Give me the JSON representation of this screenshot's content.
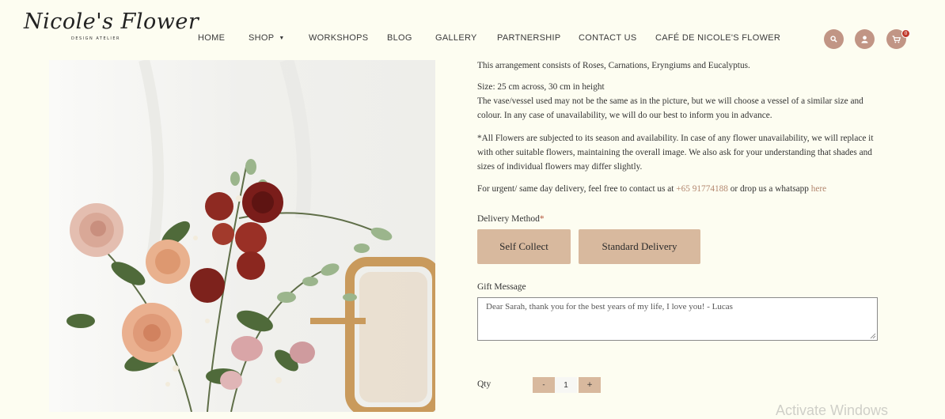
{
  "header": {
    "logo_script": "Nicole's Flower",
    "logo_subtitle": "DESIGN ATELIER",
    "nav": [
      "HOME",
      "SHOP",
      "WORKSHOPS",
      "BLOG",
      "GALLERY",
      "PARTNERSHIP",
      "CONTACT US",
      "CAFÉ DE NICOLE'S FLOWER"
    ],
    "cart_count": "0",
    "icons": [
      "search-icon",
      "user-icon",
      "cart-icon"
    ],
    "accent_color": "#c19585"
  },
  "description": {
    "p1": "This arrangement consists of Roses, Carnations, Eryngiums and Eucalyptus.",
    "size_line": "Size: 25 cm across, 30 cm in height",
    "vessel_line": "The vase/vessel used may not be the same as in the picture, but we will choose a vessel of a similar size and colour. In any case of unavailability, we will do our best to inform you in advance.",
    "note": "*All Flowers are subjected to its season and availability. In case of any flower unavailability, we will replace it with other suitable flowers, maintaining the overall image. We also ask for your understanding that shades and sizes of individual flowers may differ slightly.",
    "urgent_prefix": "For urgent/ same day delivery, feel free to contact us at",
    "phone": "+65 91774188",
    "urgent_mid": "or drop us a whatsapp",
    "here": "here"
  },
  "delivery": {
    "label": "Delivery Method",
    "required_mark": "*",
    "options": [
      "Self Collect",
      "Standard Delivery"
    ],
    "button_color": "#d8b99e"
  },
  "gift": {
    "label": "Gift Message",
    "value": "Dear Sarah, thank you for the best years of my life, I love you! - Lucas"
  },
  "qty": {
    "label": "Qty",
    "minus": "-",
    "value": "1",
    "plus": "+"
  },
  "watermark": "Activate Windows"
}
